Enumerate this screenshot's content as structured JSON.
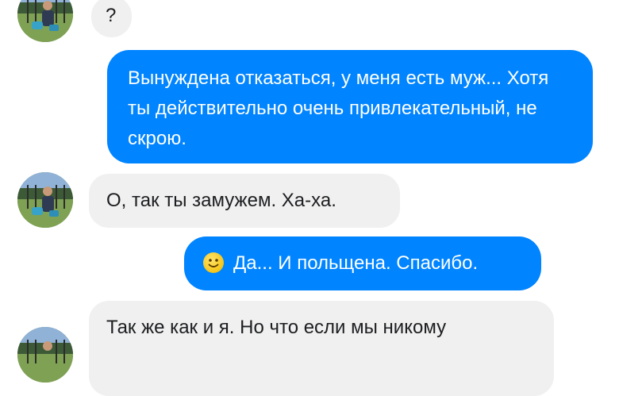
{
  "conversation": {
    "messages": [
      {
        "from": "contact",
        "text": "?"
      },
      {
        "from": "me",
        "text": "Вынуждена отказаться, у меня есть муж... Хотя ты действительно очень привлекательный, не скрою."
      },
      {
        "from": "contact",
        "text": "О, так ты замужем. Ха-ха."
      },
      {
        "from": "me",
        "emoji": "slightly-smiling-face-icon",
        "text": "Да... И польщена. Спасибо."
      },
      {
        "from": "contact",
        "text": "Так же как и я. Но что если мы никому"
      }
    ]
  },
  "colors": {
    "outgoing_bubble": "#0084ff",
    "incoming_bubble": "#f1f0f0",
    "incoming_text": "#1c1e21",
    "outgoing_text": "#ffffff"
  }
}
